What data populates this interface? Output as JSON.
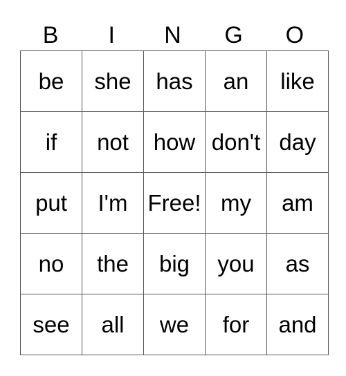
{
  "header": [
    "B",
    "I",
    "N",
    "G",
    "O"
  ],
  "rows": [
    [
      "be",
      "she",
      "has",
      "an",
      "like"
    ],
    [
      "if",
      "not",
      "how",
      "don't",
      "day"
    ],
    [
      "put",
      "I'm",
      "Free!",
      "my",
      "am"
    ],
    [
      "no",
      "the",
      "big",
      "you",
      "as"
    ],
    [
      "see",
      "all",
      "we",
      "for",
      "and"
    ]
  ]
}
